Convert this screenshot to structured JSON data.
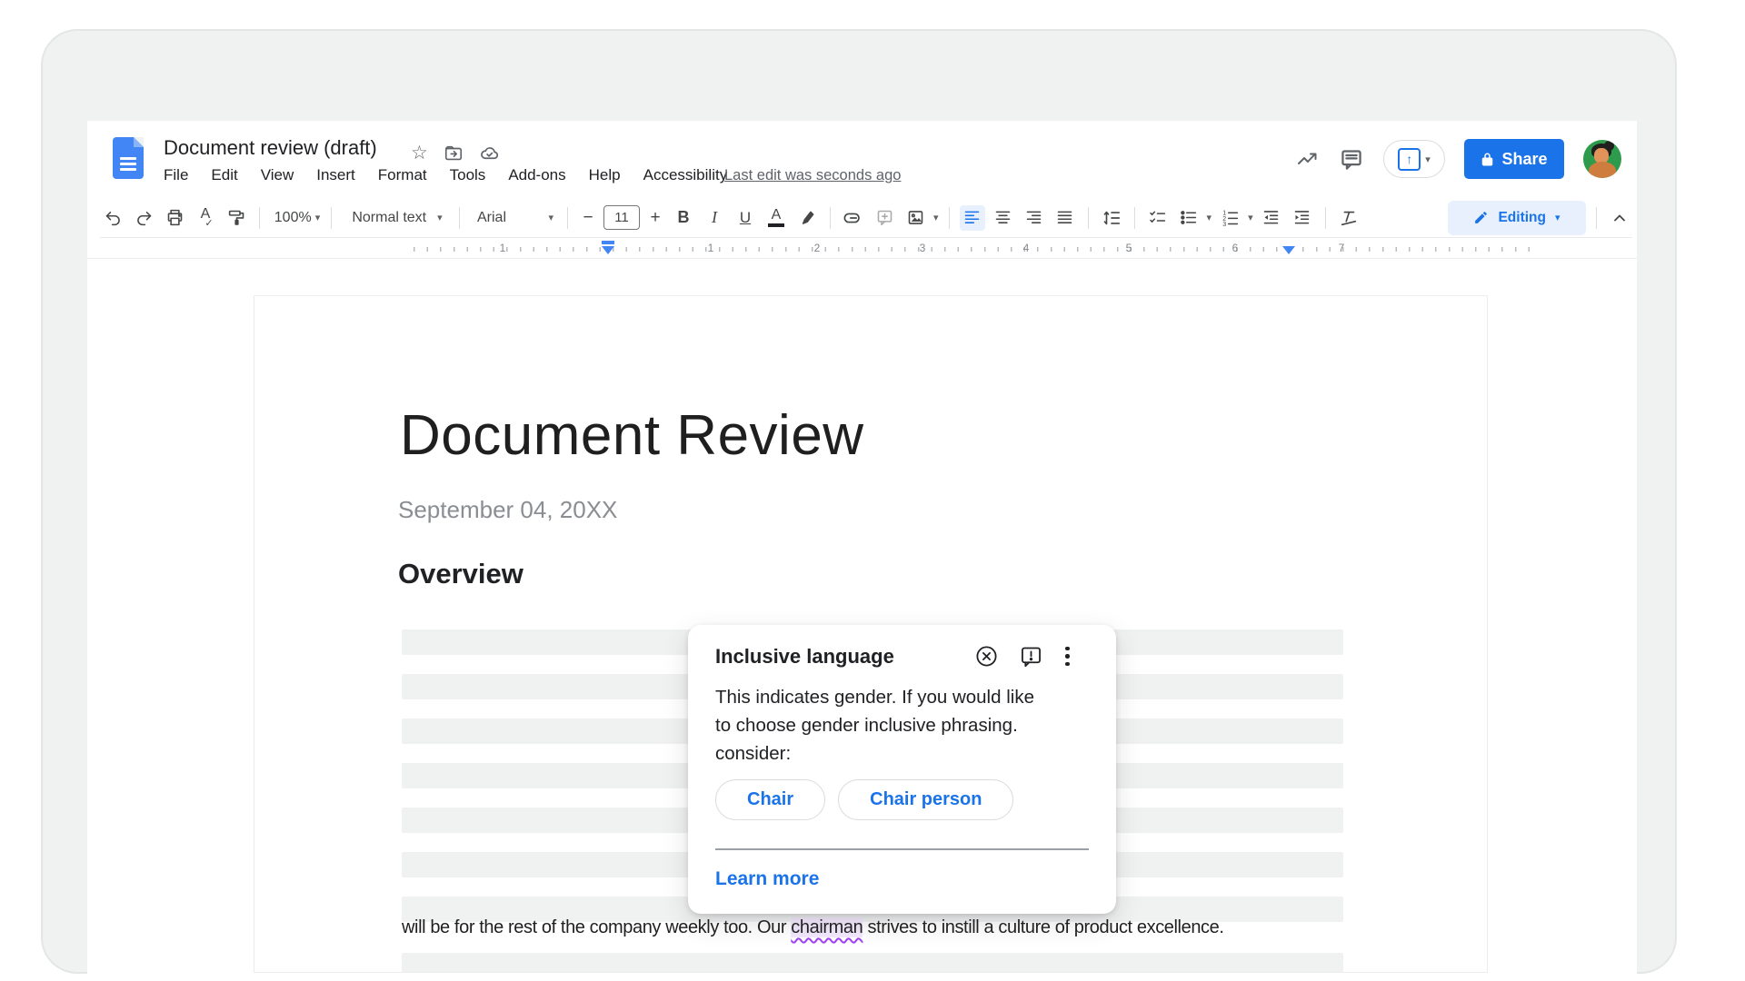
{
  "window": {
    "title": "Document review (draft)"
  },
  "menubar": {
    "items": [
      "File",
      "Edit",
      "View",
      "Insert",
      "Format",
      "Tools",
      "Add-ons",
      "Help",
      "Accessibility"
    ],
    "last_edit": "Last edit was seconds ago"
  },
  "header_actions": {
    "share": "Share"
  },
  "toolbar": {
    "zoom": "100%",
    "styles": "Normal text",
    "font": "Arial",
    "font_size": "11",
    "bold": "B",
    "italic": "I",
    "underline": "U",
    "text_color": "A",
    "spellcheck": "A",
    "mode": "Editing"
  },
  "ruler": {
    "numbers": [
      "1",
      "1",
      "2",
      "3",
      "4",
      "5",
      "6",
      "7"
    ]
  },
  "document": {
    "title": "Document Review",
    "date": "September 04, 20XX",
    "heading": "Overview",
    "paragraph_before": "will be for the rest of the company weekly too. Our ",
    "paragraph_highlight": "chairman",
    "paragraph_after": " strives to instill a culture of product excellence."
  },
  "popup": {
    "title": "Inclusive language",
    "line1": "This indicates gender. If you would like",
    "line2": "to choose gender inclusive phrasing.",
    "line3": "consider:",
    "suggestions": [
      "Chair",
      "Chair person"
    ],
    "learn_more": "Learn more"
  },
  "glyphs": {
    "star": "☆",
    "caret": "▾",
    "up_arrow": "↑",
    "check": "✓",
    "minus": "−",
    "plus": "+"
  },
  "colors": {
    "accent_blue": "#1a73e8",
    "highlight_purple": "#a142f4",
    "editing_bg": "#e8f0fe",
    "placeholder_gray": "#f0f1f1"
  }
}
